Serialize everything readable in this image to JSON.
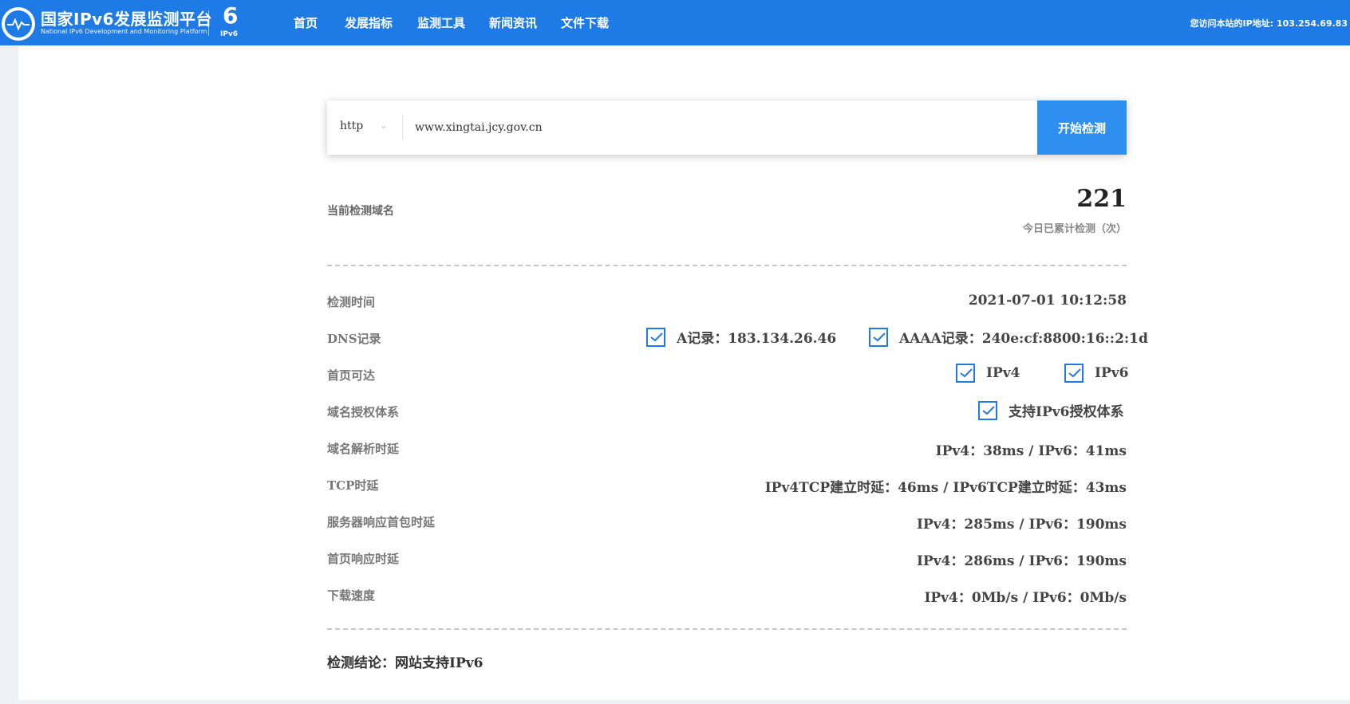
{
  "header": {
    "brand_cn": "国家IPv6发展监测平台",
    "brand_en": "National IPv6 Development and Monitoring Platform",
    "ipv6_logo_text": "IPv6",
    "nav": [
      "首页",
      "发展指标",
      "监测工具",
      "新闻资讯",
      "文件下载"
    ],
    "visitor_ip": "您访问本站的IP地址: 103.254.69.83"
  },
  "search": {
    "protocol": "http",
    "url": "www.xingtai.jcy.gov.cn",
    "button_label": "开始检测"
  },
  "stats": {
    "current_domain_label": "当前检测域名",
    "count": "221",
    "count_label": "今日已累计检测（次）"
  },
  "results": {
    "time": {
      "label": "检测时间",
      "value": "2021-07-01 10:12:58"
    },
    "dns": {
      "label": "DNS记录",
      "a_record": "A记录：183.134.26.46",
      "aaaa_record": "AAAA记录：240e:cf:8800:16::2:1d",
      "a_checked": true,
      "aaaa_checked": true
    },
    "homepage": {
      "label": "首页可达",
      "ipv4": "IPv4",
      "ipv6": "IPv6",
      "ipv4_checked": true,
      "ipv6_checked": true
    },
    "authority": {
      "label": "域名授权体系",
      "value": "支持IPv6授权体系",
      "checked": true
    },
    "dns_latency": {
      "label": "域名解析时延",
      "value": "IPv4：38ms / IPv6：41ms"
    },
    "tcp": {
      "label": "TCP时延",
      "value": "IPv4TCP建立时延：46ms / IPv6TCP建立时延：43ms"
    },
    "first_packet": {
      "label": "服务器响应首包时延",
      "value": "IPv4：285ms / IPv6：190ms"
    },
    "homepage_latency": {
      "label": "首页响应时延",
      "value": "IPv4：286ms / IPv6：190ms"
    },
    "download": {
      "label": "下载速度",
      "value": "IPv4：0Mb/s / IPv6：0Mb/s"
    }
  },
  "conclusion": "检测结论：网站支持IPv6",
  "colors": {
    "brand_blue": "#1e7be6",
    "button_blue": "#2e8ff0"
  }
}
